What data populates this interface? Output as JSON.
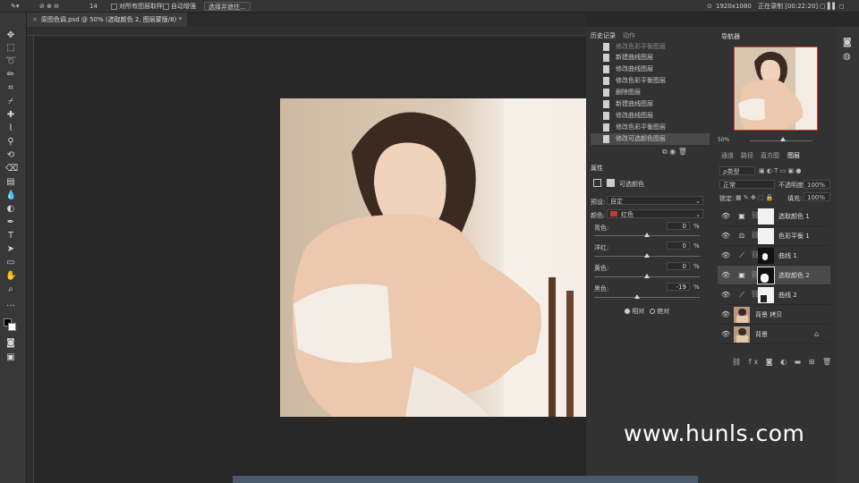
{
  "options_bar": {
    "sample_all_layers": "对所有图层取样",
    "auto_enhance": "自动增强",
    "select_and_mask": "选择并遮住...",
    "brush_size": "14",
    "resolution": "1920x1080",
    "recording": "正在录制 [00:22:20]"
  },
  "document_tab": {
    "title": "原图色调.psd @ 50% (选取颜色 2, 图层蒙版/8) *",
    "close": "×"
  },
  "history": {
    "tabs": [
      "历史记录",
      "动作"
    ],
    "items": [
      "新建曲线图层",
      "修改曲线图层",
      "修改色彩平衡图层",
      "删除图层",
      "新建曲线图层",
      "修改曲线图层",
      "修改色彩平衡图层",
      "修改可选颜色图层"
    ],
    "partial_top": "修改色彩平衡图层"
  },
  "navigator": {
    "title": "导航器",
    "zoom": "50%"
  },
  "properties": {
    "title": "属性",
    "subtitle": "可选颜色",
    "preset_label": "预设:",
    "preset_value": "自定",
    "colors_label": "颜色:",
    "colors_value": "红色",
    "colors_swatch": "#c0392b",
    "sliders": [
      {
        "label": "青色:",
        "value": "0",
        "unit": "%",
        "level": 0
      },
      {
        "label": "洋红:",
        "value": "0",
        "unit": "%",
        "level": 0
      },
      {
        "label": "黄色:",
        "value": "0",
        "unit": "%",
        "level": 0
      },
      {
        "label": "黑色:",
        "value": "-19",
        "unit": "%",
        "level": -19
      }
    ],
    "method_relative": "相对",
    "method_absolute": "绝对"
  },
  "layers_panel": {
    "tabs": [
      "通道",
      "路径",
      "直方图",
      "图层"
    ],
    "kind": "ρ类型",
    "blend_mode": "正常",
    "opacity_label": "不透明度:",
    "opacity": "100%",
    "lock_label": "锁定:",
    "fill_label": "填充:",
    "fill": "100%",
    "layers": [
      {
        "name": "选取颜色 1",
        "kind": "adjust",
        "icon": "selective-color-icon",
        "mask": "white"
      },
      {
        "name": "色彩平衡 1",
        "kind": "adjust",
        "icon": "color-balance-icon",
        "mask": "white"
      },
      {
        "name": "曲线 1",
        "kind": "adjust",
        "icon": "curves-icon",
        "mask": "black"
      },
      {
        "name": "选取颜色 2",
        "kind": "adjust",
        "icon": "selective-color-icon",
        "mask": "black",
        "selected": true
      },
      {
        "name": "曲线 2",
        "kind": "adjust",
        "icon": "curves-icon",
        "mask": "white"
      },
      {
        "name": "背景 拷贝",
        "kind": "pixel"
      },
      {
        "name": "背景",
        "kind": "pixel",
        "locked": true
      }
    ]
  },
  "watermark": "www.hunls.com"
}
